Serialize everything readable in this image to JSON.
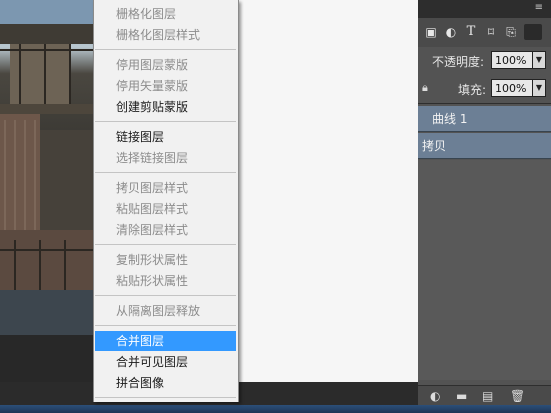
{
  "menu": {
    "items": [
      {
        "label": "栅格化图层",
        "enabled": false
      },
      {
        "label": "栅格化图层样式",
        "enabled": false
      },
      {
        "label": "停用图层蒙版",
        "enabled": false
      },
      {
        "label": "停用矢量蒙版",
        "enabled": false
      },
      {
        "label": "创建剪贴蒙版",
        "enabled": true
      },
      {
        "label": "链接图层",
        "enabled": true
      },
      {
        "label": "选择链接图层",
        "enabled": false
      },
      {
        "label": "拷贝图层样式",
        "enabled": false
      },
      {
        "label": "粘贴图层样式",
        "enabled": false
      },
      {
        "label": "清除图层样式",
        "enabled": false
      },
      {
        "label": "复制形状属性",
        "enabled": false
      },
      {
        "label": "粘贴形状属性",
        "enabled": false
      },
      {
        "label": "从隔离图层释放",
        "enabled": false
      },
      {
        "label": "合并图层",
        "enabled": true,
        "highlighted": true
      },
      {
        "label": "合并可见图层",
        "enabled": true
      },
      {
        "label": "拼合图像",
        "enabled": true
      }
    ]
  },
  "layers_panel": {
    "menu_icon": "panel-menu-icon",
    "filter_icons": [
      "pixel-filter-icon",
      "adjustment-filter-icon",
      "type-filter-icon",
      "shape-filter-icon",
      "smart-object-filter-icon"
    ],
    "opacity_label": "不透明度:",
    "opacity_value": "100%",
    "fill_label": "填充:",
    "fill_value": "100%",
    "layers": [
      {
        "name": "曲线 1",
        "selected": true
      },
      {
        "name": "拷贝",
        "selected": true
      }
    ],
    "bottom_icons": [
      "adjustment-layer-icon",
      "group-folder-icon",
      "new-layer-icon",
      "trash-icon"
    ]
  },
  "colors": {
    "highlight": "#3399ff",
    "layer_selected": "#6c7f95",
    "panel_bg": "#535353"
  }
}
